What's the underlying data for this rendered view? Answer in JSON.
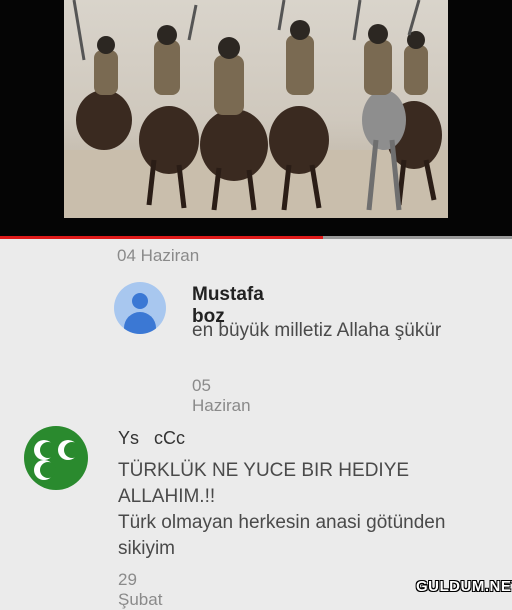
{
  "video": {
    "progress": 0.63,
    "progress_color": "#e01b1b"
  },
  "header_date": "04 Haziran",
  "comments": [
    {
      "author": "Mustafa boz",
      "avatar_icon": "default-user-icon",
      "text": "en büyük milletiz Allaha şükür",
      "date": "05 Haziran"
    },
    {
      "author": "Ys   cCc",
      "avatar_icon": "three-crescents-icon",
      "text_line1": "TÜRKLÜK NE YUCE BIR HEDIYE ALLAHIM.!!",
      "text_line2": "Türk olmayan herkesin anasi götünden sikiyim",
      "date": "29 Şubat"
    }
  ],
  "watermark": "GULDUM.NET",
  "colors": {
    "accent_red": "#e01b1b",
    "avatar_blue": "#3b78d4",
    "avatar_green": "#2a8a2e"
  }
}
